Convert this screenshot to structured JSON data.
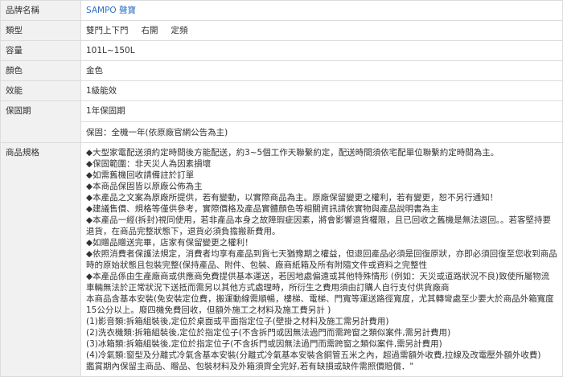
{
  "rows": {
    "brand": {
      "label": "品牌名稱",
      "value": "SAMPO 聲寶"
    },
    "type": {
      "label": "類型",
      "values": [
        "雙門上下門",
        "右開",
        "定頻"
      ]
    },
    "capacity": {
      "label": "容量",
      "value": "101L~150L"
    },
    "color": {
      "label": "顏色",
      "value": "金色"
    },
    "efficiency": {
      "label": "效能",
      "value": "1級能效"
    },
    "warranty": {
      "label": "保固期",
      "value": "1年保固期",
      "extra": "保固：全機一年(依原廠官網公告為主)"
    },
    "specs": {
      "label": "商品規格",
      "notes": [
        "◆大型家電配送須約定時間後方能配送，約3~5個工作天聯繫約定，配送時間須依宅配單位聯繫約定時間為主。",
        "◆保固範圍：非天災人為因素損壞",
        "◆如需舊機回收請備註於訂單",
        "◆本商品保固皆以原廠公佈為主",
        "◆本產品之文案為原廠所提供，若有變動，以實際商品為主。原廠保留變更之權利，若有變更，恕不另行通知！",
        "◆建議售價、規格等僅供參考，實際價格及產品實體顏色等相關資訊請依實物與產品說明書為主",
        "◆本產品一經(拆封)視同使用，若非產品本身之故障瑕疵因素，將會影響退貨權限，且已回收之舊機是無法退回。。若客堅持要退貨，在商品完整狀態下，退貨必須負擔搬新費用。",
        "◆如贈品贈送完畢，店家有保留變更之權利！",
        "◆依照消費者保護法規定，消費者均享有產品到貨七天猶豫期之權益，但退回產品必須是回復原狀，亦即必須回復至您收到商品時的原始狀態且包裝完整(保持產品、附件、包裝、廠商紙箱及所有附隨文件或資料之完整性",
        "◆本產品係由生產廠商或供應商免費提供基本運送，若因地處偏遠或其他特殊情形 (例如：天災或道路狀況不良)致使所屬物流車輛無法於正常狀況下送抵而需另以其他方式處理時，所衍生之費用須由訂購人自行支付供貨廠商",
        "本商品含基本安裝(免安裝定位費，搬運動線需順暢，樓梯、電梯、門寬等運送路徑寬度，尤其轉彎處至少要大於商品外箱寬度15公分以上。廢四機免費回收，但額外施工之材料及施工費另計 )",
        "(1)影音類:拆箱組裝後,定位於桌面或平面指定位子(壁掛之材料及施工需另計費用)",
        "(2)洗衣機類:拆箱組裝後,定位於指定位子(不含拆門或因無法過門而需跨窗之類似案件,需另計費用)",
        "(3)冰箱類:拆箱組裝後,定位於指定位子(不含拆門或因無法過門而需跨窗之類似案件,需另計費用)",
        "(4)冷氣類:窗型及分離式冷氣含基本安裝(分離式冷氣基本安裝含銅管五米之內，超過需額外收費,拉線及改電壓外額外收費)",
        "鑑賞期內保留主商品、贈品、包裝材料及外箱須齊全完好,若有缺損或缺件需照價賠償．\""
      ]
    }
  }
}
